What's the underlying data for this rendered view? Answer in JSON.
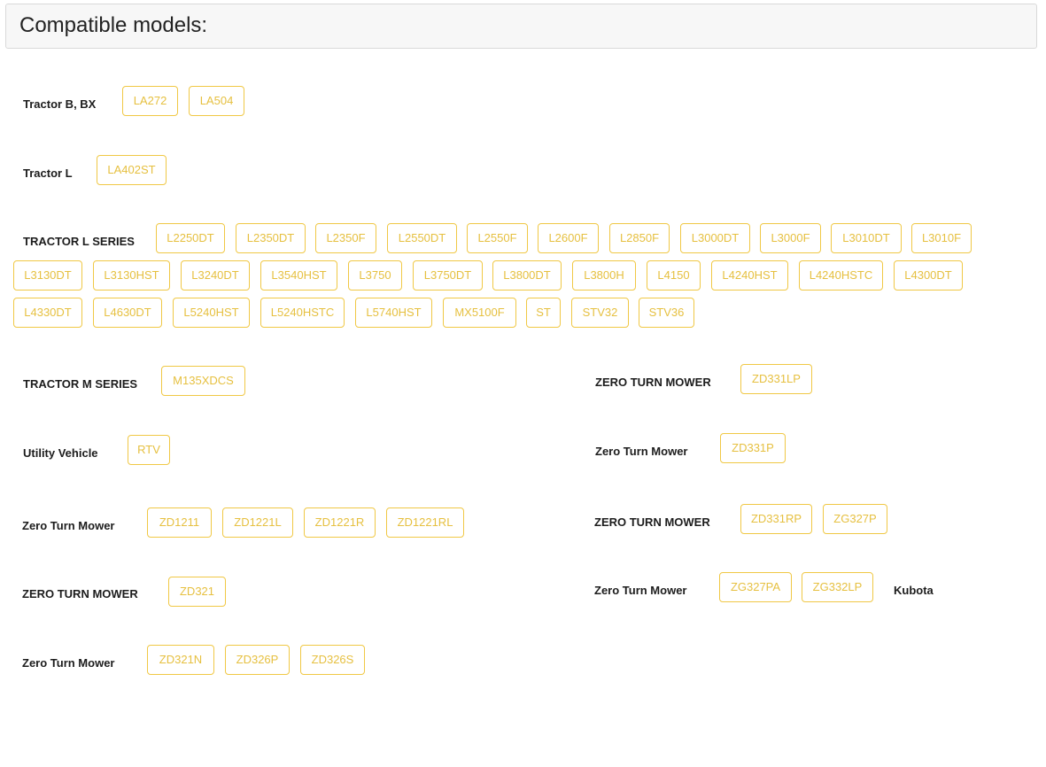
{
  "header": {
    "title": "Compatible models:"
  },
  "categories": {
    "tractor_b_bx": {
      "label": "Tractor B, BX",
      "models": [
        "LA272",
        "LA504"
      ]
    },
    "tractor_l": {
      "label": "Tractor L",
      "models": [
        "LA402ST"
      ]
    },
    "tractor_l_series": {
      "label": "TRACTOR L SERIES",
      "models": [
        "L2250DT",
        "L2350DT",
        "L2350F",
        "L2550DT",
        "L2550F",
        "L2600F",
        "L2850F",
        "L3000DT",
        "L3000F",
        "L3010DT",
        "L3010F",
        "L3130DT",
        "L3130HST",
        "L3240DT",
        "L3540HST",
        "L3750",
        "L3750DT",
        "L3800DT",
        "L3800H",
        "L4150",
        "L4240HST",
        "L4240HSTC",
        "L4300DT",
        "L4330DT",
        "L4630DT",
        "L5240HST",
        "L5240HSTC",
        "L5740HST",
        "MX5100F",
        "ST",
        "STV32",
        "STV36"
      ]
    },
    "tractor_m_series": {
      "label": "TRACTOR M SERIES",
      "models": [
        "M135XDCS"
      ]
    },
    "utility_vehicle": {
      "label": "Utility Vehicle",
      "models": [
        "RTV"
      ]
    },
    "zero_turn_1": {
      "label": "Zero Turn Mower",
      "models": [
        "ZD1211",
        "ZD1221L",
        "ZD1221R",
        "ZD1221RL"
      ]
    },
    "zero_turn_2": {
      "label": "ZERO TURN MOWER",
      "models": [
        "ZD321"
      ]
    },
    "zero_turn_3": {
      "label": "Zero Turn Mower",
      "models": [
        "ZD321N",
        "ZD326P",
        "ZD326S"
      ]
    },
    "zero_turn_4": {
      "label": "ZERO TURN MOWER",
      "models": [
        "ZD331LP"
      ]
    },
    "zero_turn_5": {
      "label": "Zero Turn Mower",
      "models": [
        "ZD331P"
      ]
    },
    "zero_turn_6": {
      "label": "ZERO TURN MOWER",
      "models": [
        "ZD331RP",
        "ZG327P"
      ]
    },
    "zero_turn_7": {
      "label": "Zero Turn Mower",
      "models": [
        "ZG327PA",
        "ZG332LP"
      ]
    }
  },
  "brand": {
    "label": "Kubota"
  },
  "colors": {
    "tag_border": "#f0c845",
    "tag_text": "#e6c040",
    "header_bg": "#f7f7f7"
  }
}
